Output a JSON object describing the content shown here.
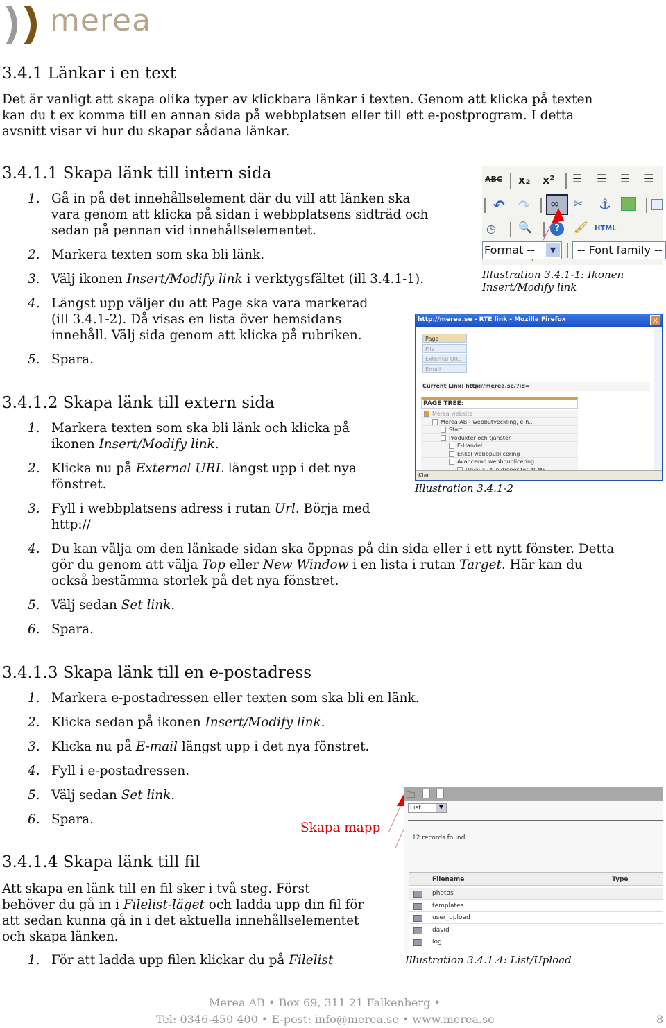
{
  "logo": {
    "text": "merea",
    "colors": {
      "left": "#9a9a9a",
      "right": "#7a5414",
      "text": "#b5a58a"
    }
  },
  "sections": {
    "s341": {
      "title": "3.4.1 Länkar i en text",
      "paragraph": [
        "Det är vanligt att skapa olika typer av klickbara länkar i texten. Genom att klicka på texten",
        "kan du t ex komma till en annan sida på webbplatsen eller till ett e-postprogram. I detta",
        "avsnitt visar vi hur du skapar sådana länkar."
      ]
    },
    "s3411": {
      "title": "3.4.1.1 Skapa länk till intern sida",
      "items": [
        {
          "n": "1.",
          "lines": [
            [
              {
                "t": "Gå in på det innehållselement där du vill att länken ska"
              }
            ],
            [
              {
                "t": "vara genom att klicka på sidan i webbplatsens sidträd och"
              }
            ],
            [
              {
                "t": "sedan på pennan vid innehållselementet."
              }
            ]
          ]
        },
        {
          "n": "2.",
          "lines": [
            [
              {
                "t": "Markera texten som ska bli länk."
              }
            ]
          ]
        },
        {
          "n": "3.",
          "lines": [
            [
              {
                "t": "Välj ikonen "
              },
              {
                "t": "Insert/Modify link",
                "i": true
              },
              {
                "t": " i verktygsfältet (ill 3.4.1-1)."
              }
            ]
          ]
        },
        {
          "n": "4.",
          "lines": [
            [
              {
                "t": "Längst upp väljer du att Page ska vara markerad"
              }
            ],
            [
              {
                "t": "(ill 3.4.1-2). Då visas en lista över hemsidans"
              }
            ],
            [
              {
                "t": "innehåll. Välj sida genom att klicka på rubriken."
              }
            ]
          ]
        },
        {
          "n": "5.",
          "lines": [
            [
              {
                "t": "Spara."
              }
            ]
          ]
        }
      ]
    },
    "s3412": {
      "title": "3.4.1.2 Skapa länk till extern sida",
      "items": [
        {
          "n": "1.",
          "lines": [
            [
              {
                "t": "Markera texten som ska bli länk och klicka på"
              }
            ],
            [
              {
                "t": "ikonen "
              },
              {
                "t": "Insert/Modify link",
                "i": true
              },
              {
                "t": "."
              }
            ]
          ]
        },
        {
          "n": "2.",
          "lines": [
            [
              {
                "t": "Klicka nu på "
              },
              {
                "t": "External URL",
                "i": true
              },
              {
                "t": " längst upp i det nya"
              }
            ],
            [
              {
                "t": "fönstret."
              }
            ]
          ]
        },
        {
          "n": "3.",
          "lines": [
            [
              {
                "t": "Fyll i webbplatsens adress i rutan "
              },
              {
                "t": "Url",
                "i": true
              },
              {
                "t": ". Börja med"
              }
            ],
            [
              {
                "t": "http://"
              }
            ]
          ]
        },
        {
          "n": "4.",
          "lines": [
            [
              {
                "t": "Du kan välja om den länkade sidan ska öppnas på din sida eller i ett nytt fönster. Detta"
              }
            ],
            [
              {
                "t": "gör du genom att välja "
              },
              {
                "t": "Top",
                "i": true
              },
              {
                "t": " eller "
              },
              {
                "t": "New Window",
                "i": true
              },
              {
                "t": " i en lista i rutan "
              },
              {
                "t": "Target",
                "i": true
              },
              {
                "t": ". Här kan du"
              }
            ],
            [
              {
                "t": "också bestämma storlek på det nya fönstret."
              }
            ]
          ]
        },
        {
          "n": "5.",
          "lines": [
            [
              {
                "t": "Välj sedan "
              },
              {
                "t": "Set link",
                "i": true
              },
              {
                "t": "."
              }
            ]
          ]
        },
        {
          "n": "6.",
          "lines": [
            [
              {
                "t": "Spara."
              }
            ]
          ]
        }
      ]
    },
    "s3413": {
      "title": "3.4.1.3 Skapa länk till en e-postadress",
      "items": [
        {
          "n": "1.",
          "lines": [
            [
              {
                "t": "Markera e-postadressen eller texten som ska bli en länk."
              }
            ]
          ]
        },
        {
          "n": "2.",
          "lines": [
            [
              {
                "t": "Klicka sedan på ikonen "
              },
              {
                "t": "Insert/Modify link",
                "i": true
              },
              {
                "t": "."
              }
            ]
          ]
        },
        {
          "n": "3.",
          "lines": [
            [
              {
                "t": "Klicka nu på "
              },
              {
                "t": "E-mail",
                "i": true
              },
              {
                "t": " längst upp i det nya fönstret."
              }
            ]
          ]
        },
        {
          "n": "4.",
          "lines": [
            [
              {
                "t": "Fyll i e-postadressen."
              }
            ]
          ]
        },
        {
          "n": "5.",
          "lines": [
            [
              {
                "t": "Välj sedan "
              },
              {
                "t": "Set link",
                "i": true
              },
              {
                "t": "."
              }
            ]
          ]
        },
        {
          "n": "6.",
          "lines": [
            [
              {
                "t": "Spara."
              }
            ]
          ]
        }
      ]
    },
    "s3414": {
      "title": "3.4.1.4 Skapa länk till fil",
      "paragraph": [
        [
          {
            "t": "Att skapa en länk till en fil sker i två steg. Först"
          }
        ],
        [
          {
            "t": "behöver du gå in i "
          },
          {
            "t": "Filelist-läget",
            "i": true
          },
          {
            "t": " och ladda upp din fil för"
          }
        ],
        [
          {
            "t": "att sedan kunna gå in i det aktuella innehållselementet"
          }
        ],
        [
          {
            "t": "och skapa länken."
          }
        ]
      ],
      "items": [
        {
          "n": "1.",
          "lines": [
            [
              {
                "t": "För att ladda upp filen klickar du på "
              },
              {
                "t": "Filelist",
                "i": true
              }
            ]
          ]
        }
      ]
    }
  },
  "annotation": {
    "text": "Skapa mapp",
    "color": "#e00000"
  },
  "ill1": {
    "caption": [
      "Illustration 3.4.1-1: Ikonen",
      "Insert/Modify link"
    ],
    "format": "Format --",
    "font_family": "-- Font family --",
    "html": "HTML",
    "abc": "ABC"
  },
  "ill2": {
    "title": "http://merea.se - RTE link - Mozilla Firefox",
    "tabs": [
      "Page",
      "File",
      "External URL",
      "Email"
    ],
    "current_link": "Current Link: http://merea.se/?id=",
    "tree_title": "PAGE TREE:",
    "tree": [
      "Merea website",
      "Merea AB - webbutveckling, e-h...",
      "Start",
      "Produkter och tjänster",
      "E-Handel",
      "Enkel webbpublicering",
      "Avancerad webbpublicering",
      "Urval av funktioner för ACMS"
    ],
    "status": "Klar",
    "caption": "Illustration 3.4.1-2"
  },
  "ill3": {
    "view": "List",
    "records": "12 records found.",
    "col_filename": "Filename",
    "col_type": "Type",
    "files": [
      "photos",
      "templates",
      "user_upload",
      "david",
      "log"
    ],
    "caption": "Illustration 3.4.1.4: List/Upload"
  },
  "footer": {
    "line1": "Merea AB  •  Box 69, 311 21 Falkenberg  •",
    "line2": "Tel: 0346-450 400  •  E-post: info@merea.se   •  www.merea.se",
    "page": "8"
  }
}
